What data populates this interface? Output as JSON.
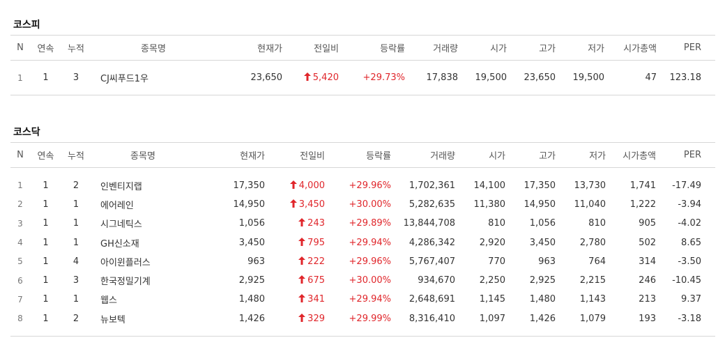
{
  "headers": [
    "N",
    "연속",
    "누적",
    "종목명",
    "현재가",
    "전일비",
    "등락률",
    "거래량",
    "시가",
    "고가",
    "저가",
    "시가총액",
    "PER"
  ],
  "colors": {
    "up": "#e0262b",
    "border": "#d6d6d6"
  },
  "icons": {
    "up": "up-arrow-icon"
  },
  "kospi": {
    "title": "코스피",
    "rows": [
      {
        "n": "1",
        "streak": "1",
        "total": "3",
        "name": "CJ씨푸드1우",
        "price": "23,650",
        "change": "5,420",
        "rate": "+29.73%",
        "volume": "17,838",
        "open": "19,500",
        "high": "23,650",
        "low": "19,500",
        "mcap": "47",
        "per": "123.18"
      }
    ]
  },
  "kosdaq": {
    "title": "코스닥",
    "rows": [
      {
        "n": "1",
        "streak": "1",
        "total": "2",
        "name": "인벤티지랩",
        "price": "17,350",
        "change": "4,000",
        "rate": "+29.96%",
        "volume": "1,702,361",
        "open": "14,100",
        "high": "17,350",
        "low": "13,730",
        "mcap": "1,741",
        "per": "-17.49"
      },
      {
        "n": "2",
        "streak": "1",
        "total": "1",
        "name": "에어레인",
        "price": "14,950",
        "change": "3,450",
        "rate": "+30.00%",
        "volume": "5,282,635",
        "open": "11,380",
        "high": "14,950",
        "low": "11,040",
        "mcap": "1,222",
        "per": "-3.94"
      },
      {
        "n": "3",
        "streak": "1",
        "total": "1",
        "name": "시그네틱스",
        "price": "1,056",
        "change": "243",
        "rate": "+29.89%",
        "volume": "13,844,708",
        "open": "810",
        "high": "1,056",
        "low": "810",
        "mcap": "905",
        "per": "-4.02"
      },
      {
        "n": "4",
        "streak": "1",
        "total": "1",
        "name": "GH신소재",
        "price": "3,450",
        "change": "795",
        "rate": "+29.94%",
        "volume": "4,286,342",
        "open": "2,920",
        "high": "3,450",
        "low": "2,780",
        "mcap": "502",
        "per": "8.65"
      },
      {
        "n": "5",
        "streak": "1",
        "total": "4",
        "name": "아이윈플러스",
        "price": "963",
        "change": "222",
        "rate": "+29.96%",
        "volume": "5,767,407",
        "open": "770",
        "high": "963",
        "low": "764",
        "mcap": "314",
        "per": "-3.50"
      },
      {
        "n": "6",
        "streak": "1",
        "total": "3",
        "name": "한국정밀기계",
        "price": "2,925",
        "change": "675",
        "rate": "+30.00%",
        "volume": "934,670",
        "open": "2,250",
        "high": "2,925",
        "low": "2,215",
        "mcap": "246",
        "per": "-10.45"
      },
      {
        "n": "7",
        "streak": "1",
        "total": "1",
        "name": "웹스",
        "price": "1,480",
        "change": "341",
        "rate": "+29.94%",
        "volume": "2,648,691",
        "open": "1,145",
        "high": "1,480",
        "low": "1,143",
        "mcap": "213",
        "per": "9.37"
      },
      {
        "n": "8",
        "streak": "1",
        "total": "2",
        "name": "뉴보텍",
        "price": "1,426",
        "change": "329",
        "rate": "+29.99%",
        "volume": "8,316,410",
        "open": "1,097",
        "high": "1,426",
        "low": "1,079",
        "mcap": "193",
        "per": "-3.18"
      }
    ]
  }
}
